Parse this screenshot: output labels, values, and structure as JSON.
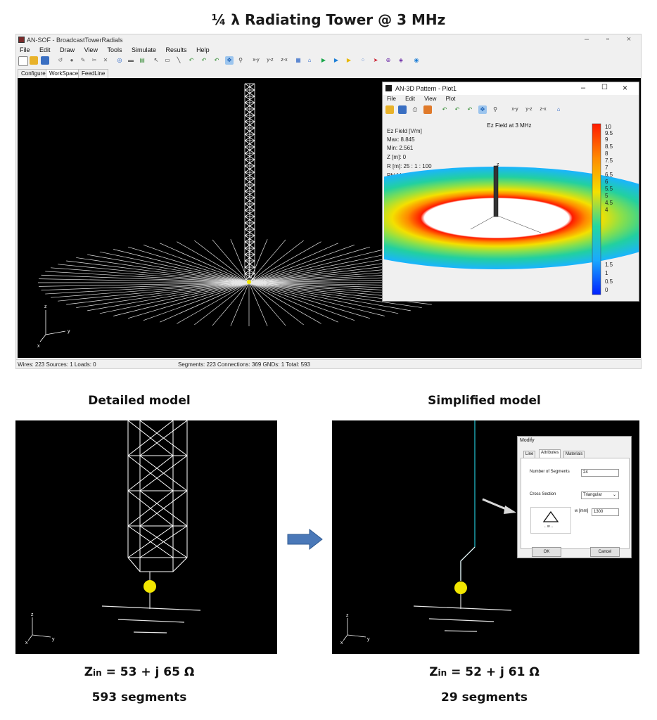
{
  "page_title": "¼ λ  Radiating Tower @ 3 MHz",
  "app": {
    "window_title": "AN-SOF - BroadcastTowerRadials",
    "menu": [
      "File",
      "Edit",
      "Draw",
      "View",
      "Tools",
      "Simulate",
      "Results",
      "Help"
    ],
    "tabs": [
      "Configure",
      "WorkSpace",
      "FeedLine"
    ],
    "active_tab": "WorkSpace",
    "toolbar_labels": {
      "xy": "x-y",
      "yz": "y-z",
      "zx": "z-x"
    },
    "axes": {
      "x": "x",
      "y": "y",
      "z": "z"
    },
    "status": {
      "left": "Wires: 223  Sources: 1  Loads: 0",
      "right": "Segments: 223  Connections: 369  GNDs: 1  Total: 593"
    }
  },
  "plot_window": {
    "title": "AN-3D Pattern - Plot1",
    "menu": [
      "File",
      "Edit",
      "View",
      "Plot"
    ],
    "toolbar_labels": {
      "xy": "x-y",
      "yz": "y-z",
      "zx": "z-x"
    },
    "heading": "Ez Field at 3 MHz",
    "info": [
      "Ez Field [V/m]",
      "Max: 8.845",
      "Min: 2.561",
      "Z [m]: 0",
      "R [m]: 25 : 1 : 100",
      "Phi [deg]: 0 : 5 : 360"
    ],
    "colorbar_ticks": [
      "10",
      "9.5",
      "9",
      "8.5",
      "8",
      "7.5",
      "7",
      "6.5",
      "6",
      "5.5",
      "5",
      "4.5",
      "4",
      "1.5",
      "1",
      "0.5",
      "0"
    ],
    "z_axis_label": "z"
  },
  "detailed": {
    "heading": "Detailed model",
    "zin_prefix": "Z",
    "zin_sub": "in",
    "zin_value": " = 53 + j 65 Ω",
    "segments": "593 segments"
  },
  "simplified": {
    "heading": "Simplified model",
    "zin_prefix": "Z",
    "zin_sub": "in",
    "zin_value": " = 52 + j 61 Ω",
    "segments": "29 segments"
  },
  "modify_dialog": {
    "title": "Modify",
    "tabs": [
      "Line",
      "Attributes",
      "Materials"
    ],
    "active_tab": "Attributes",
    "num_segments_label": "Number of Segments",
    "num_segments_value": "24",
    "cross_section_label": "Cross Section",
    "cross_section_value": "Triangular",
    "w_label": "w  [mm]",
    "w_value": "1300",
    "shape_dim_label": "←w→",
    "ok_label": "OK",
    "cancel_label": "Cancel"
  },
  "colors": {
    "accent_arrow": "#4a78b8",
    "feed_dot": "#f2e600",
    "wire": "#ffffff",
    "cyan_wire": "#21c6d6"
  }
}
